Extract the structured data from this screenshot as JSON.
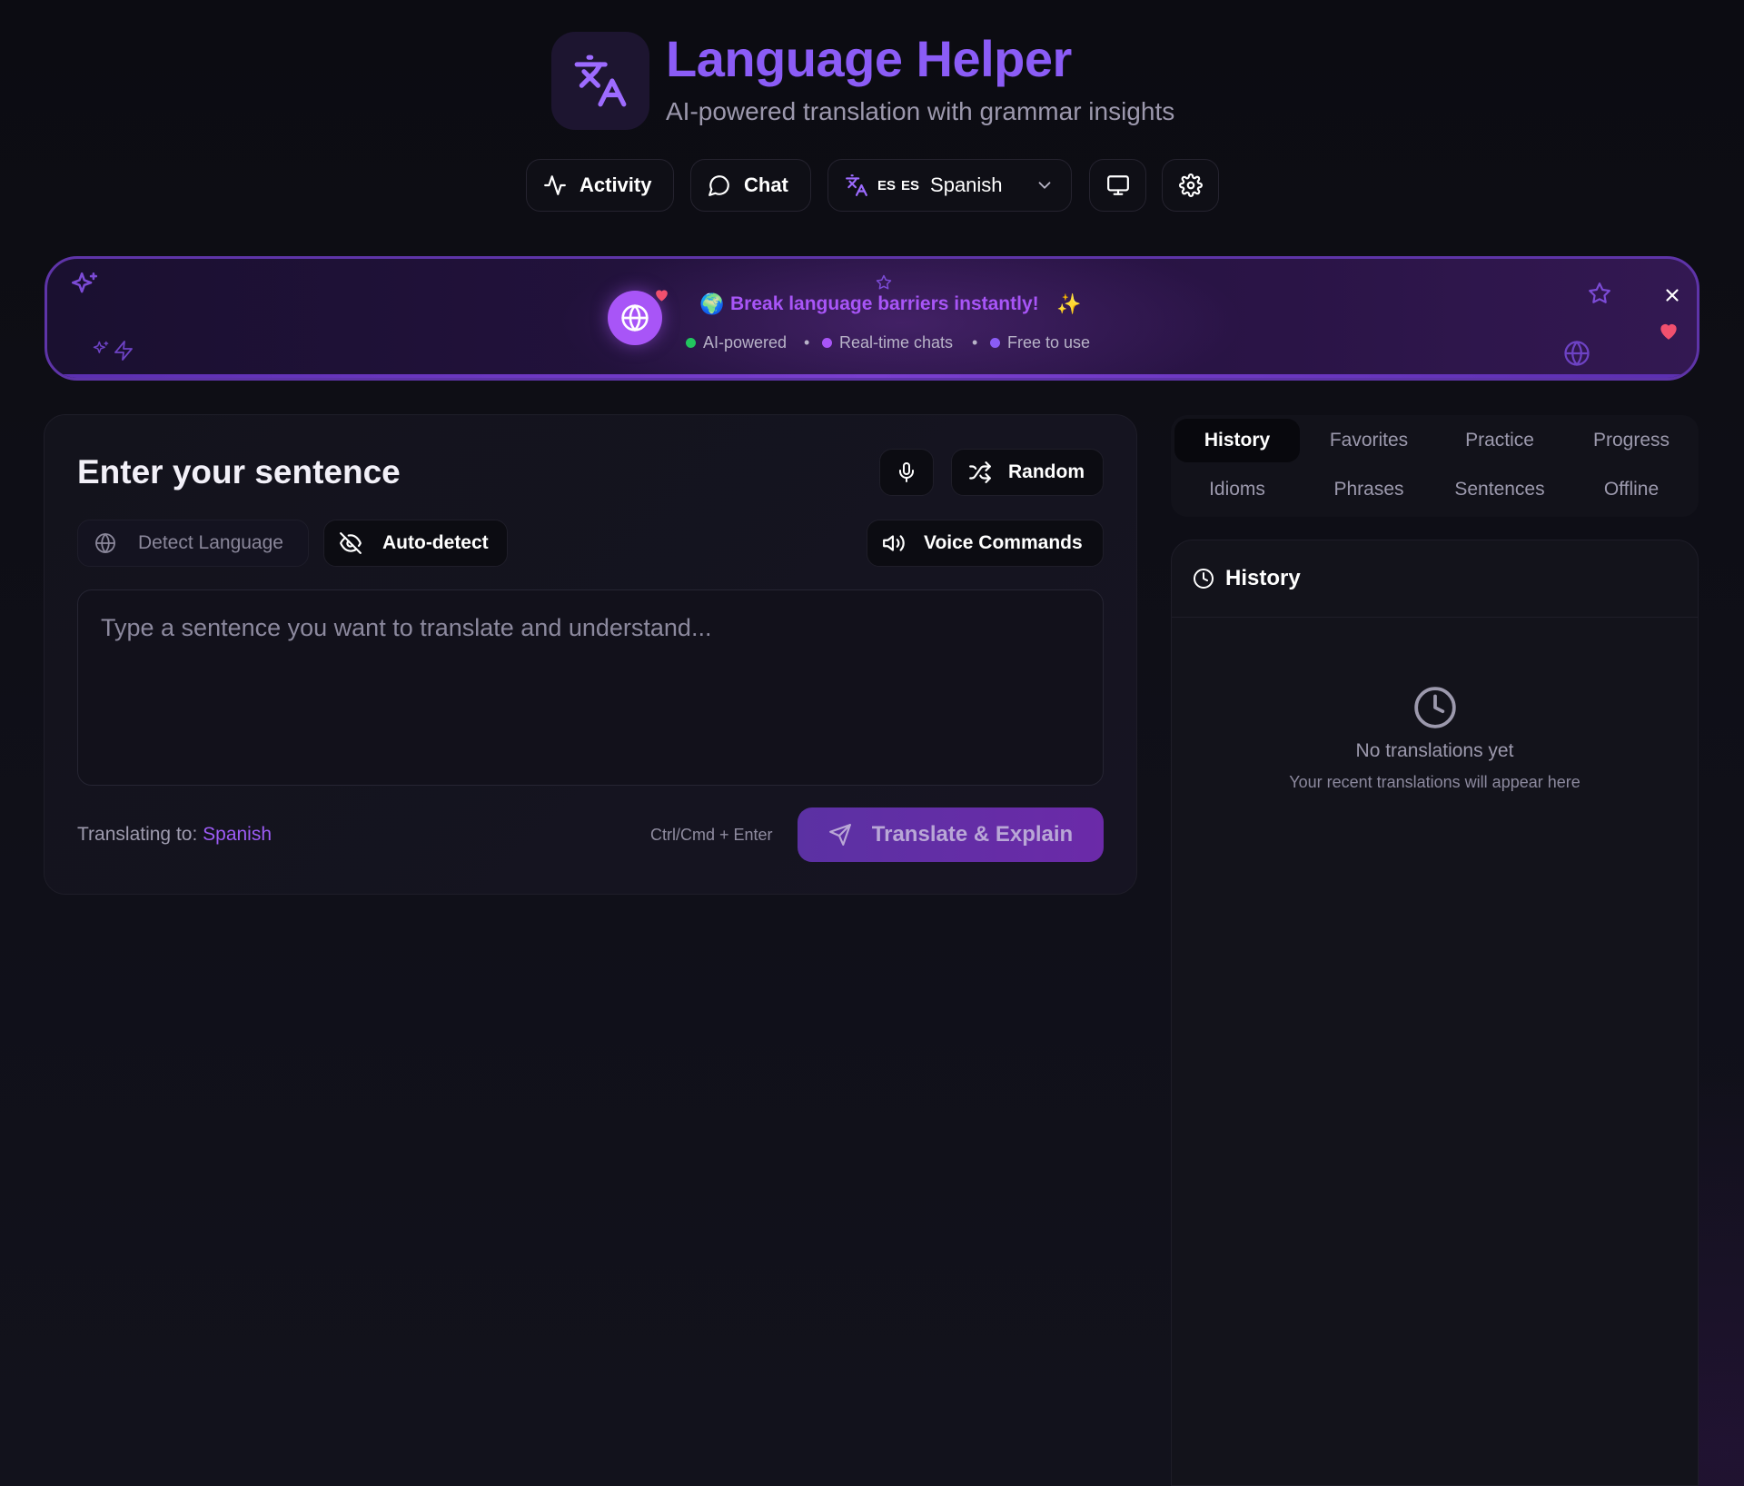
{
  "header": {
    "title": "Language Helper",
    "subtitle": "AI-powered translation with grammar insights",
    "logo_icon": "translate-icon"
  },
  "nav": {
    "activity_label": "Activity",
    "chat_label": "Chat",
    "language_code_1": "ES",
    "language_code_2": "ES",
    "language_label": "Spanish"
  },
  "banner": {
    "emoji_globe": "🌍",
    "title": "Break language barriers instantly!",
    "emoji_sparkle": "✨",
    "features": [
      "AI-powered",
      "Real-time chats",
      "Free to use"
    ],
    "feature_colors": [
      "#22c55e",
      "#a855f7",
      "#8b5cf6"
    ],
    "separator": "•"
  },
  "input_card": {
    "title": "Enter your sentence",
    "random_label": "Random",
    "detect_label": "Detect Language",
    "autodetect_label": "Auto-detect",
    "voice_label": "Voice Commands",
    "placeholder": "Type a sentence you want to translate and understand...",
    "translating_prefix": "Translating to:",
    "translating_language": "Spanish",
    "shortcut": "Ctrl/Cmd + Enter",
    "submit_label": "Translate & Explain"
  },
  "tabs": {
    "row1": [
      "History",
      "Favorites",
      "Practice",
      "Progress"
    ],
    "row2": [
      "Idioms",
      "Phrases",
      "Sentences",
      "Offline"
    ],
    "active": "History"
  },
  "history": {
    "title": "History",
    "empty_title": "No translations yet",
    "empty_subtitle": "Your recent translations will appear here"
  },
  "colors": {
    "accent": "#8b5cf6",
    "accent_bright": "#a855f7",
    "background": "#0c0c12",
    "heart": "#f0506e"
  }
}
